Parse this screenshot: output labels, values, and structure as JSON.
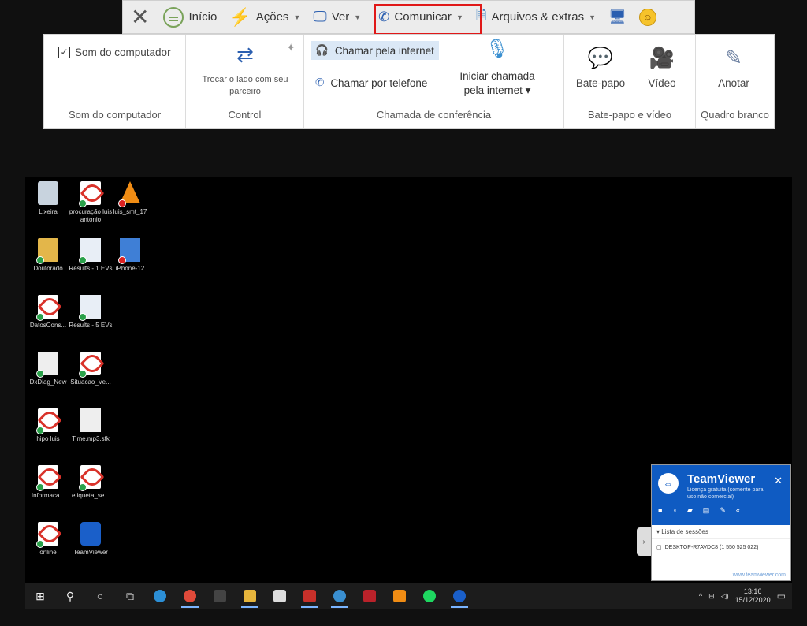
{
  "toolbar": {
    "inicio": "Início",
    "acoes": "Ações",
    "ver": "Ver",
    "comunicar": "Comunicar",
    "arquivos": "Arquivos & extras"
  },
  "ribbon": {
    "som_check": "Som do computador",
    "som_group": "Som do computador",
    "trocar": "Trocar o lado com seu parceiro",
    "control_group": "Control",
    "chamar_internet": "Chamar pela internet",
    "chamar_telefone": "Chamar por telefone",
    "iniciar_l1": "Iniciar chamada",
    "iniciar_l2": "pela internet ▾",
    "conferencia_group": "Chamada de conferência",
    "batepapo": "Bate-papo",
    "video": "Vídeo",
    "chat_group": "Bate-papo e vídeo",
    "anotar": "Anotar",
    "quadro_group": "Quadro branco"
  },
  "desktop_icons": [
    {
      "label": "Lixeira"
    },
    {
      "label": "procuração luis antonio"
    },
    {
      "label": "luis_smt_17"
    },
    {
      "label": "Doutorado"
    },
    {
      "label": "Results - 1 EVs"
    },
    {
      "label": "iPhone-12"
    },
    {
      "label": "DatosCons..."
    },
    {
      "label": "Results - 5 EVs"
    },
    {
      "label": "DxDiag_New"
    },
    {
      "label": "Situacao_Ve..."
    },
    {
      "label": "hipo luis"
    },
    {
      "label": "Time.mp3.sfk"
    },
    {
      "label": "Informaca..."
    },
    {
      "label": "etiqueta_se..."
    },
    {
      "label": "online"
    },
    {
      "label": "TeamViewer"
    }
  ],
  "teamviewer": {
    "name": "TeamViewer",
    "license": "Licença gratuita (somente para uso não comercial)",
    "sessions": "Lista de sessões",
    "session_row": "DESKTOP-R7AVDC8 (1 550 525 022)",
    "footer": "www.teamviewer.com"
  },
  "taskbar": {
    "time": "13:16",
    "date": "15/12/2020"
  }
}
